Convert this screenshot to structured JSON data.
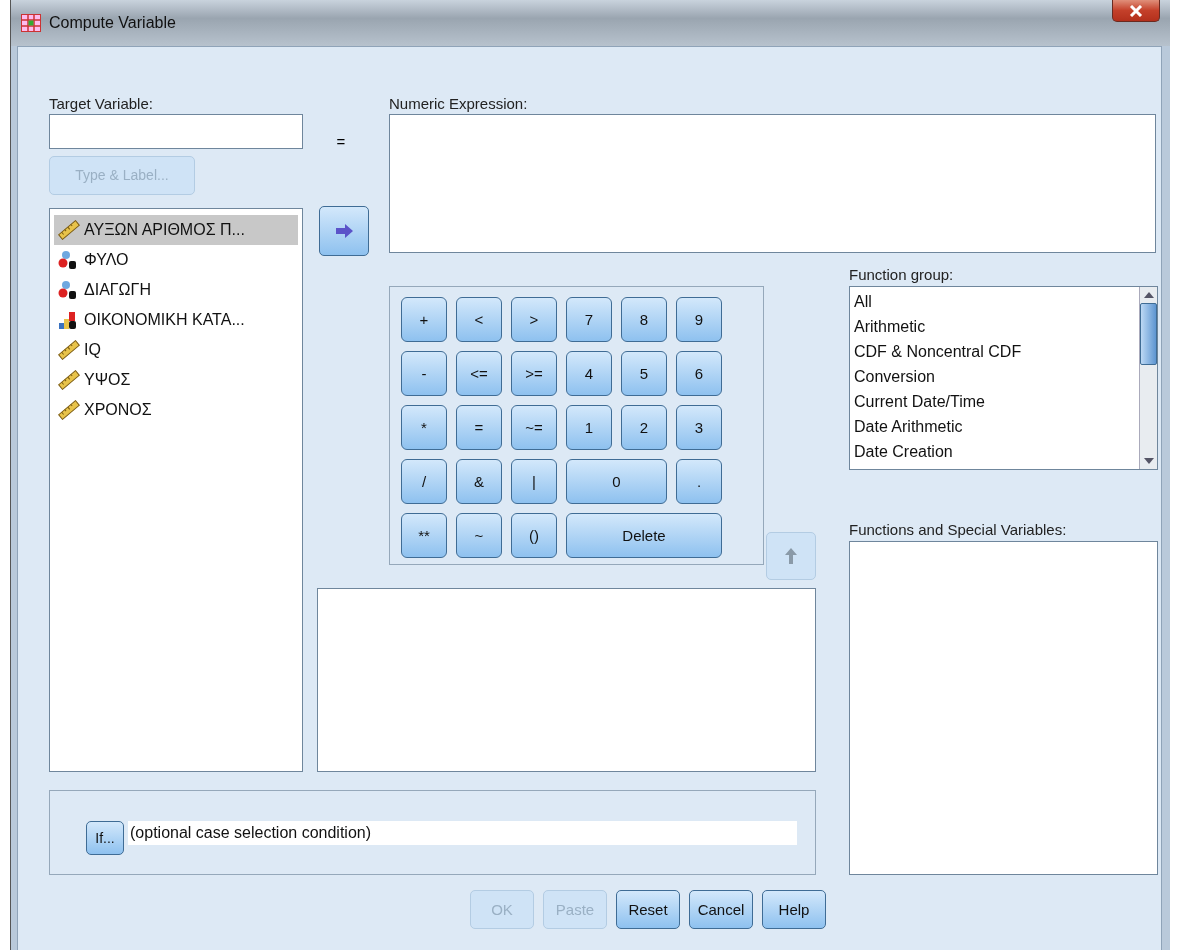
{
  "window": {
    "title": "Compute Variable"
  },
  "target_variable": {
    "label": "Target Variable:",
    "equals": "=",
    "type_label_button": {
      "label": "Type & Label...",
      "disabled": true
    }
  },
  "variables": [
    {
      "name": "ΑΥΞΩΝ ΑΡΙΘΜΟΣ Π...",
      "kind": "scale",
      "selected": true
    },
    {
      "name": "ΦΥΛΟ",
      "kind": "nominal",
      "selected": false
    },
    {
      "name": "ΔΙΑΓΩΓΗ",
      "kind": "nominal",
      "selected": false
    },
    {
      "name": "ΟΙΚΟΝΟΜΙΚΗ ΚΑΤΑ...",
      "kind": "ordinal",
      "selected": false
    },
    {
      "name": "IQ",
      "kind": "scale",
      "selected": false
    },
    {
      "name": "ΥΨΟΣ",
      "kind": "scale",
      "selected": false
    },
    {
      "name": "ΧΡΟΝΟΣ",
      "kind": "scale",
      "selected": false
    }
  ],
  "numeric_expression": {
    "label": "Numeric Expression:"
  },
  "keypad": [
    [
      "+",
      "<",
      ">",
      "7",
      "8",
      "9"
    ],
    [
      "-",
      "<=",
      ">=",
      "4",
      "5",
      "6"
    ],
    [
      "*",
      "=",
      "~=",
      "1",
      "2",
      "3"
    ],
    [
      "/",
      "&",
      "|",
      "0",
      "."
    ],
    [
      "**",
      "~",
      "()",
      "Delete"
    ]
  ],
  "function_group": {
    "label": "Function group:",
    "items": [
      {
        "label": "All",
        "selected": false
      },
      {
        "label": "Arithmetic",
        "selected": false
      },
      {
        "label": "CDF & Noncentral CDF",
        "selected": false
      },
      {
        "label": "Conversion",
        "selected": false
      },
      {
        "label": "Current Date/Time",
        "selected": false
      },
      {
        "label": "Date Arithmetic",
        "selected": false
      },
      {
        "label": "Date Creation",
        "selected": false
      }
    ]
  },
  "functions_special_variables": {
    "label": "Functions and Special Variables:"
  },
  "if_condition": {
    "button": "If...",
    "value": "(optional case selection condition)"
  },
  "buttons": [
    {
      "label": "OK",
      "disabled": true
    },
    {
      "label": "Paste",
      "disabled": true
    },
    {
      "label": "Reset",
      "disabled": false
    },
    {
      "label": "Cancel",
      "disabled": false
    },
    {
      "label": "Help",
      "disabled": false
    }
  ]
}
